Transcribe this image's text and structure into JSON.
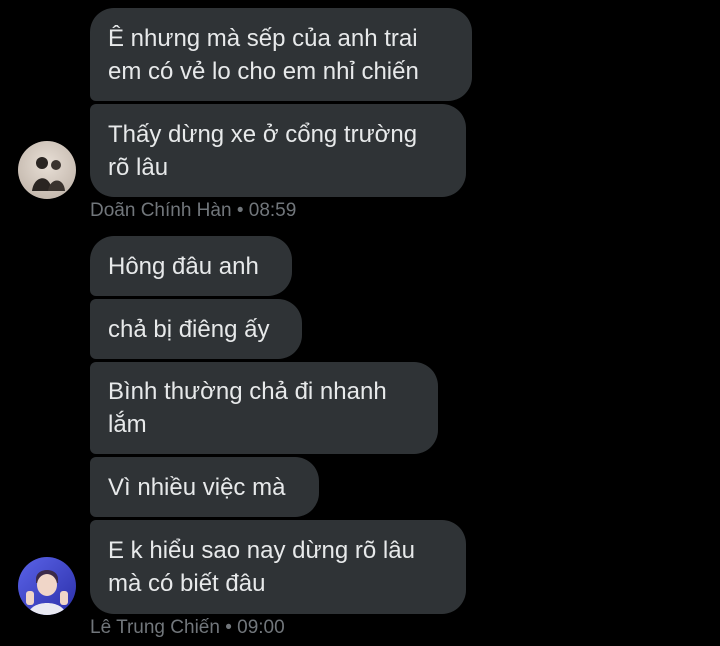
{
  "conversation": {
    "group1": {
      "messages": [
        "Ê nhưng mà sếp của anh trai\nem có vẻ lo cho em nhỉ chiến",
        "Thấy dừng xe ở cổng trường\nrõ lâu"
      ],
      "sender": "Doãn Chính Hàn",
      "time": "08:59"
    },
    "group2": {
      "messages": [
        "Hông đâu anh",
        "chả bị điêng ấy",
        "Bình thường chả đi nhanh\nlắm",
        "Vì nhiều việc mà",
        "E k hiểu sao nay dừng rõ lâu\nmà có biết đâu"
      ],
      "sender": "Lê Trung Chiến",
      "time": "09:00"
    },
    "separator": "•"
  },
  "colors": {
    "background": "#000000",
    "bubble": "#2f3336",
    "text": "#e7e9ea",
    "meta": "#71767b"
  }
}
